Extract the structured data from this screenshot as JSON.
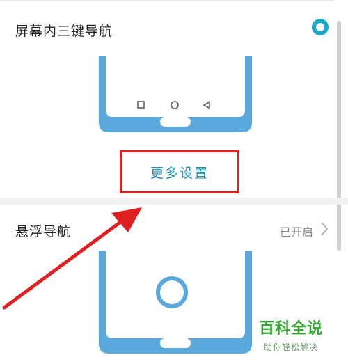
{
  "nav_three_key": {
    "title": "屏幕内三键导航",
    "more_settings_label": "更多设置"
  },
  "nav_floating": {
    "title": "悬浮导航",
    "status": "已开启"
  },
  "watermark": {
    "title": "百科全说",
    "subtitle": "助你轻松解决"
  },
  "colors": {
    "accent": "#19a8cc",
    "phone_blue": "#5aa8dc",
    "annotation_red": "#e02020",
    "watermark_green": "#2fa82f"
  }
}
